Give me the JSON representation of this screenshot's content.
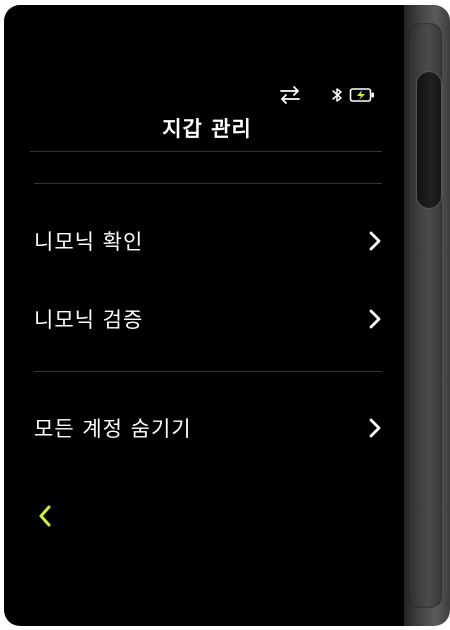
{
  "header": {
    "title": "지갑 관리"
  },
  "status": {
    "icons": [
      "transfer-icon",
      "bluetooth-icon",
      "battery-charging-icon"
    ],
    "accent_color": "#c6f432"
  },
  "menu": {
    "items": [
      {
        "label": "니모닉 확인"
      },
      {
        "label": "니모닉 검증"
      },
      {
        "label": "모든 계정 숨기기"
      }
    ]
  },
  "nav": {
    "back_icon": "chevron-left-icon",
    "back_color": "#c6f432"
  }
}
